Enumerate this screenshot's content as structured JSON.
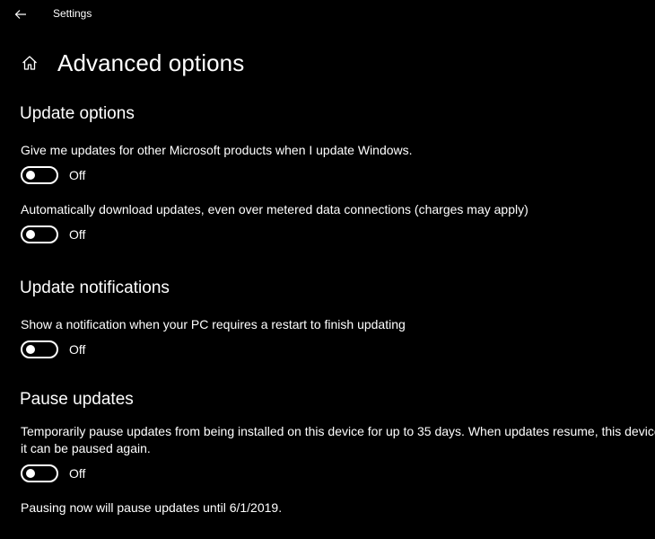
{
  "window": {
    "title": "Settings"
  },
  "header": {
    "title": "Advanced options"
  },
  "sections": {
    "update_options": {
      "title": "Update options",
      "items": [
        {
          "label": "Give me updates for other Microsoft products when I update Windows.",
          "state": "Off"
        },
        {
          "label": "Automatically download updates, even over metered data connections (charges may apply)",
          "state": "Off"
        }
      ]
    },
    "update_notifications": {
      "title": "Update notifications",
      "items": [
        {
          "label": "Show a notification when your PC requires a restart to finish updating",
          "state": "Off"
        }
      ]
    },
    "pause_updates": {
      "title": "Pause updates",
      "line1": "Temporarily pause updates from being installed on this device for up to 35 days. When updates resume, this device will need to get the latest updates before",
      "line2": "it can be paused again.",
      "state": "Off",
      "note": "Pausing now will pause updates until 6/1/2019."
    }
  },
  "colors": {
    "background": "#000000",
    "foreground": "#ffffff"
  },
  "icons": {
    "back": "back-arrow-icon",
    "home": "home-icon",
    "toggle": "toggle-switch-off"
  }
}
